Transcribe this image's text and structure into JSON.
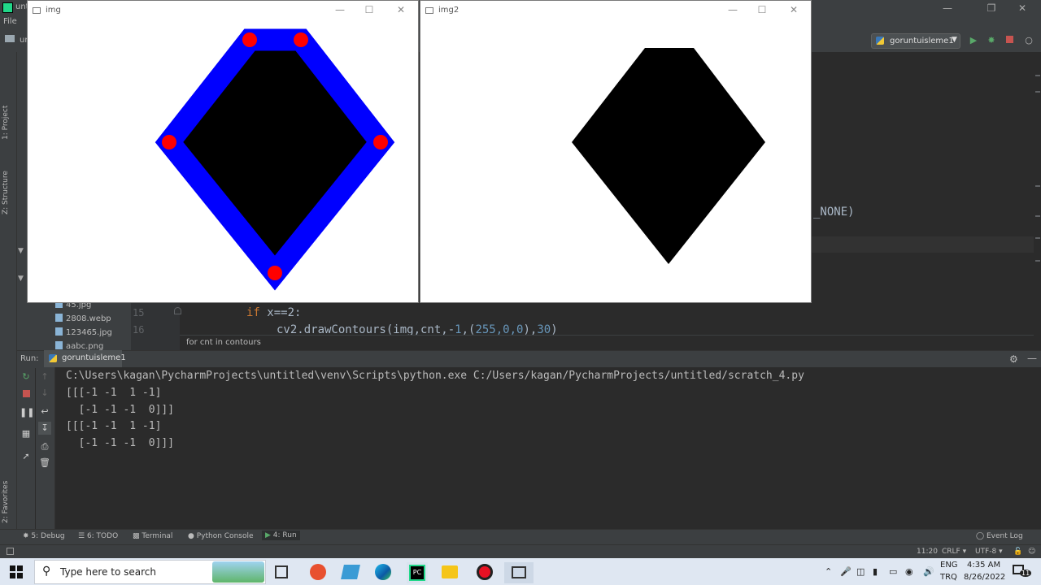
{
  "ide": {
    "title": "unt",
    "menu_file": "File",
    "project_label": "ur",
    "run_config": "goruntuisleme1",
    "left_tabs": {
      "project": "1: Project",
      "structure": "Z: Structure",
      "favorites": "2: Favorites"
    },
    "tree": [
      "45.jpg",
      "2808.webp",
      "123465.jpg",
      "aabc.png"
    ],
    "line_numbers": [
      "15",
      "16"
    ],
    "code_if_kw": "if",
    "code_if_rest": " x==2:",
    "code_draw_a": "cv2.drawContours(img,cnt,-",
    "code_draw_num1": "1",
    "code_draw_b": ",(",
    "code_draw_num2": "255,0,0",
    "code_draw_c": "),",
    "code_draw_num3": "30",
    "code_draw_d": ")",
    "code_fragment": "_NONE)",
    "breadcrumb": "for cnt in contours",
    "run_label": "Run:",
    "run_tab": "goruntuisleme1",
    "console": [
      "C:\\Users\\kagan\\PycharmProjects\\untitled\\venv\\Scripts\\python.exe C:/Users/kagan/PycharmProjects/untitled/scratch_4.py",
      "[[[-1 -1  1 -1]",
      "  [-1 -1 -1  0]]]",
      "[[[-1 -1  1 -1]",
      "  [-1 -1 -1  0]]]"
    ],
    "bottom_tabs": [
      "5: Debug",
      "6: TODO",
      "Terminal",
      "Python Console",
      "4: Run"
    ],
    "event_log": "Event Log",
    "status": {
      "position": "11:20",
      "line_sep": "CRLF",
      "encoding": "UTF-8"
    }
  },
  "windows": [
    {
      "title": "img"
    },
    {
      "title": "img2"
    }
  ],
  "colors": {
    "contour": "#0000ff",
    "points": "#ff0000",
    "shape": "#000000"
  },
  "taskbar": {
    "search_placeholder": "Type here to search",
    "lang1": "ENG",
    "lang2": "TRQ",
    "time": "4:35 AM",
    "date": "8/26/2022",
    "notif_count": "11"
  }
}
